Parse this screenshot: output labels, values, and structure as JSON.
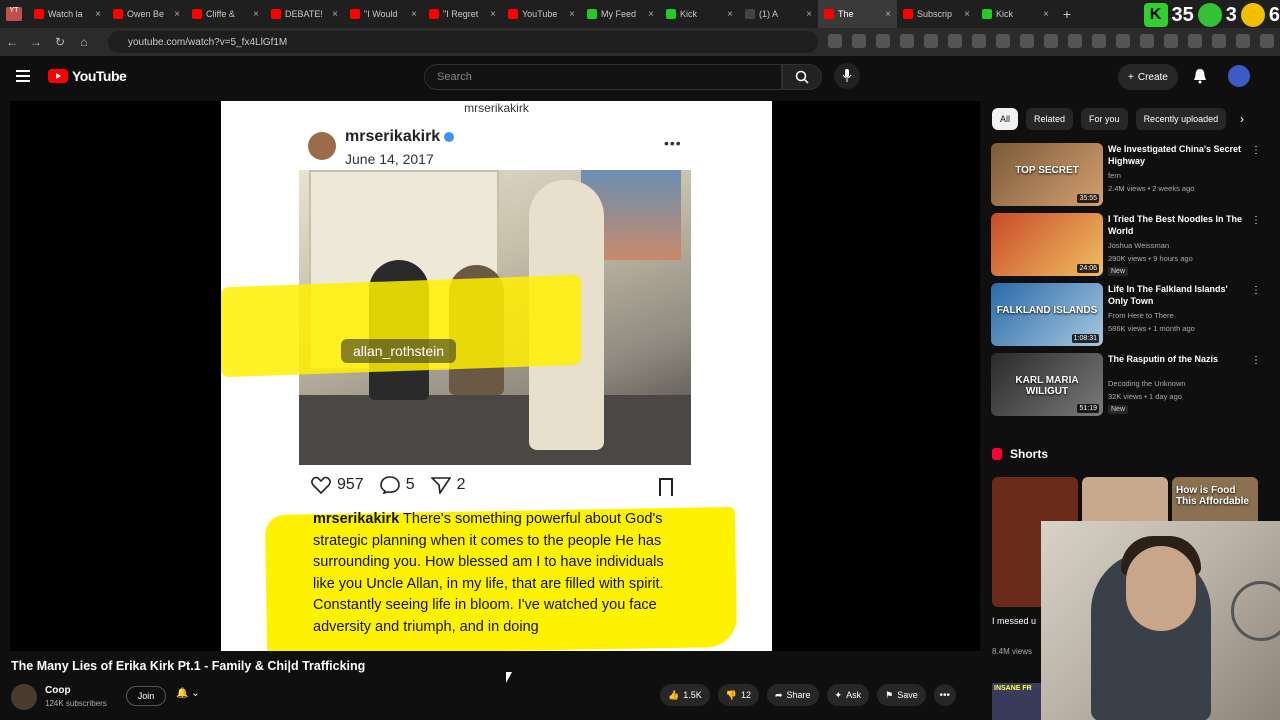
{
  "browser": {
    "tabs": [
      {
        "label": "Watch la",
        "color": "#ff0000"
      },
      {
        "label": "Owen Be",
        "color": "#ff0000"
      },
      {
        "label": "Cliffe &",
        "color": "#ff0000"
      },
      {
        "label": "DEBATE!",
        "color": "#ff0000"
      },
      {
        "label": "\"I Would",
        "color": "#ff0000"
      },
      {
        "label": "\"I Regret",
        "color": "#ff0000"
      },
      {
        "label": "YouTube",
        "color": "#ff0000"
      },
      {
        "label": "My Feed",
        "color": "#22cc22"
      },
      {
        "label": "Kick",
        "color": "#22cc22"
      },
      {
        "label": "(1) A",
        "color": "#444444"
      },
      {
        "label": "The",
        "color": "#ff0000"
      },
      {
        "label": "Subscrip",
        "color": "#ff0000"
      },
      {
        "label": "Kick",
        "color": "#22cc22"
      }
    ],
    "first_tab_icon": "YT",
    "new_tab": "+",
    "url": "youtube.com/watch?v=5_fx4LlGf1M",
    "ext_number_1": "35",
    "ext_number_2": "3",
    "ext_number_3": "6",
    "ext_k": "K"
  },
  "header": {
    "logo_text": "YouTube",
    "search_placeholder": "Search",
    "create_label": "Create"
  },
  "player": {
    "post_header": "mrserikakirk",
    "username": "mrserikakirk",
    "date": "June 14, 2017",
    "tag": "allan_rothstein",
    "likes": "957",
    "comments": "5",
    "shares": "2",
    "caption_user": "mrserikakirk",
    "caption_text": "There's something powerful about God's strategic planning when it comes to the people He has surrounding you. How blessed am I to have individuals like you Uncle Allan, in my life, that are filled with spirit. Constantly seeing life in bloom. I've watched you face adversity and triumph, and in doing"
  },
  "video": {
    "title": "The Many Lies of Erika Kirk Pt.1 - Family & Chi|d Trafficking",
    "channel": "Coop",
    "subscribers": "124K subscribers",
    "join_label": "Join",
    "likes": "1.5K",
    "dislikes": "12",
    "share_label": "Share",
    "ask_label": "Ask",
    "save_label": "Save"
  },
  "sidebar": {
    "chips": [
      "All",
      "Related",
      "For you",
      "Recently uploaded"
    ],
    "recommendations": [
      {
        "title": "We Investigated China's Secret Highway",
        "channel": "fern",
        "meta": "2.4M views • 2 weeks ago",
        "duration": "35:55",
        "thumb_text": "TOP SECRET",
        "badge": ""
      },
      {
        "title": "I Tried The Best Noodles In The World",
        "channel": "Joshua Weissman",
        "meta": "290K views • 9 hours ago",
        "duration": "24:06",
        "thumb_text": "",
        "badge": "New"
      },
      {
        "title": "Life In The Falkland Islands' Only Town",
        "channel": "From Here to There",
        "meta": "586K views • 1 month ago",
        "duration": "1:08:31",
        "thumb_text": "FALKLAND ISLANDS",
        "badge": ""
      },
      {
        "title": "The Rasputin of the Nazis",
        "channel": "Decoding the Unknown",
        "meta": "32K views • 1 day ago",
        "duration": "51:19",
        "thumb_text": "KARL MARIA WILIGUT",
        "badge": "New"
      }
    ],
    "shorts_title": "Shorts",
    "shorts": [
      {
        "thumb_text": "",
        "color": "#6b2a1a"
      },
      {
        "thumb_text": "",
        "color": "#c9a98e"
      },
      {
        "thumb_text": "How is Food This Affordable",
        "color": "#8a7050"
      }
    ],
    "short_label": "I messed u",
    "short_views": "8.4M views",
    "bottom_thumb_text": "INSANE FR"
  }
}
